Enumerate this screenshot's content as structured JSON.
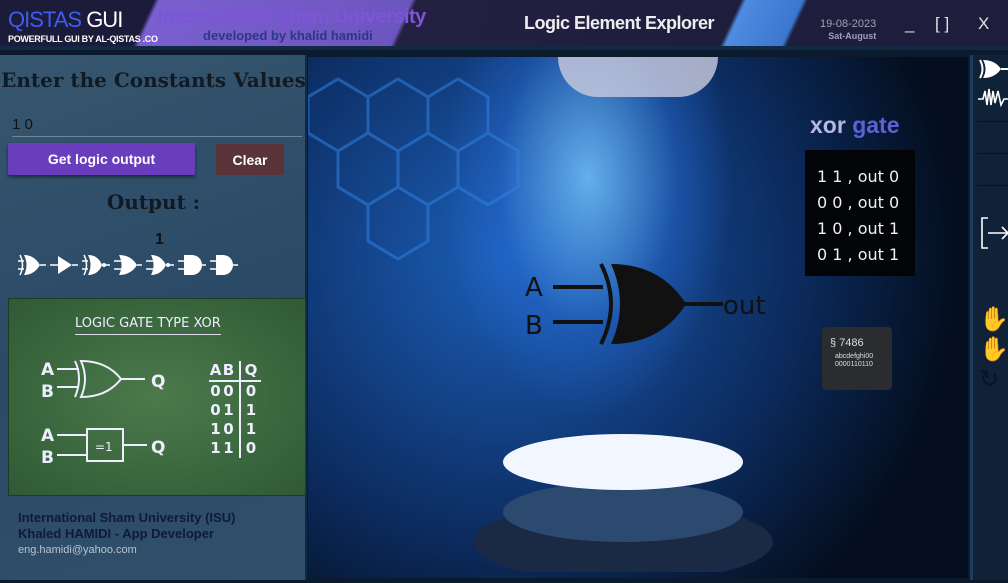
{
  "titlebar": {
    "logo_blue": "QISTAS",
    "logo_white": "GUI",
    "logo_sub": "POWERFULL GUI BY AL-QISTAS .CO",
    "university": "International Sham University",
    "developed_by": "developed by khalid hamidi",
    "app_title": "Logic Element Explorer",
    "date": "19-08-2023",
    "month": "Sat-August",
    "minimize": "_",
    "maximize": "[ ]",
    "close": "X"
  },
  "left": {
    "enter_title": "Enter the Constants Values",
    "input_value": "1 0",
    "get_button": "Get logic output",
    "clear_button": "Clear",
    "output_title": "Output :",
    "output_value": "1",
    "gate_icons": [
      "xor-gate-icon",
      "buffer-gate-icon",
      "xnor-gate-icon",
      "or-gate-icon",
      "nor-gate-icon",
      "and-gate-icon",
      "nand-gate-icon"
    ],
    "board": {
      "title": "LOGIC GATE TYPE XOR",
      "A": "A",
      "B": "B",
      "Q": "Q",
      "box_label": "=1",
      "headers": [
        "A",
        "B",
        "Q"
      ],
      "rows": [
        [
          "0",
          "0",
          "0"
        ],
        [
          "0",
          "1",
          "1"
        ],
        [
          "1",
          "0",
          "1"
        ],
        [
          "1",
          "1",
          "0"
        ]
      ]
    },
    "footer": {
      "line1": "International Sham University (ISU)",
      "line2": "Khaled HAMIDI - App Developer",
      "email": "eng.hamidi@yahoo.com"
    }
  },
  "main": {
    "gate_word": "xor",
    "gate_suffix": "gate",
    "truth_lines": [
      "1 1 , out 0",
      "0 0 , out 0",
      "1 0 , out 1",
      "0 1 , out 1"
    ],
    "input_a": "A",
    "input_b": "B",
    "out_label": "out",
    "chip_number": "7486",
    "chip_line1": "abcdefghi00",
    "chip_line2": "0000110110"
  },
  "colors": {
    "accent": "#6a3dbd",
    "clear": "#5a3338",
    "board": "#3f6e42"
  }
}
